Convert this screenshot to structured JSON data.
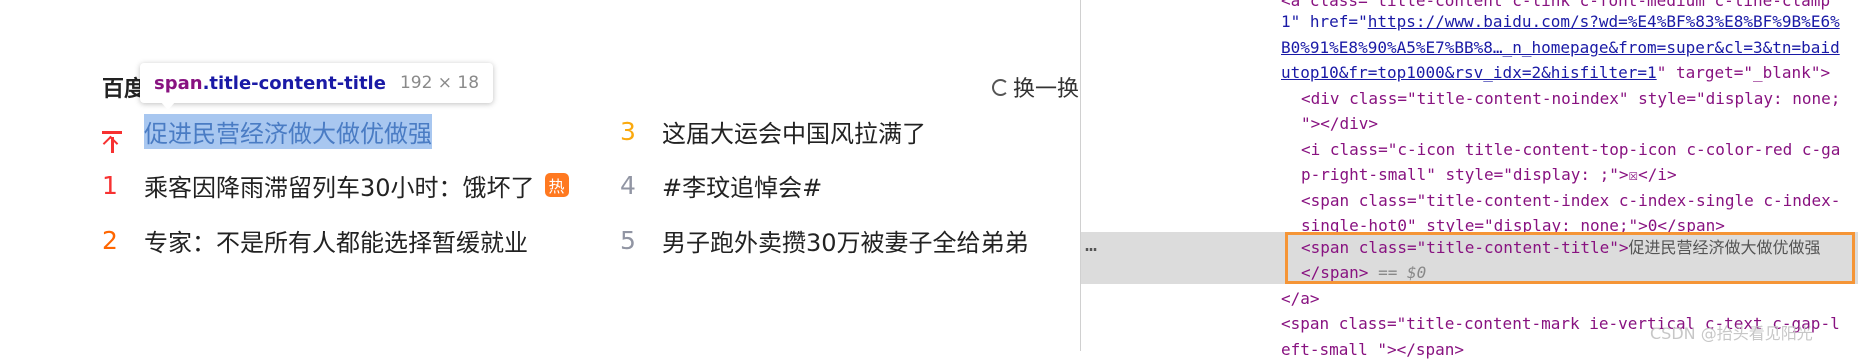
{
  "hot_search": {
    "title": "百度",
    "refresh_label": "换一换",
    "refresh_icon": "refresh-icon",
    "hot_badge": "热",
    "rows": [
      {
        "index": "",
        "title": "促进民营经济做大做优做强",
        "pinned": true
      },
      {
        "index": "1",
        "title": "乘客因降雨滞留列车30小时：饿坏了",
        "badge": "热"
      },
      {
        "index": "2",
        "title": "专家：不是所有人都能选择暂缓就业"
      },
      {
        "index": "3",
        "title": "这届大运会中国风拉满了"
      },
      {
        "index": "4",
        "title": "#李玟追悼会#"
      },
      {
        "index": "5",
        "title": "男子跑外卖攒30万被妻子全给弟弟"
      }
    ]
  },
  "tooltip": {
    "tag": "span",
    "class": ".title-content-title",
    "size": "192 × 18"
  },
  "devtools": {
    "line0": "<a class=\"title-content  c-link c-font-medium c-line-clamp",
    "line1_prefix": "1\" href=\"",
    "line1_link": "https://www.baidu.com/s?wd=%E4%BF%83%E8%BF%9B%E6%",
    "line2_link": "B0%91%E8%90%A5%E7%BB%8…_n_homepage&from=super&cl=3&tn=baid",
    "line3_link": "utop10&fr=top1000&rsv_idx=2&hisfilter=1",
    "line3_suffix": "\" target=\"_blank\">",
    "line4": "<div class=\"title-content-noindex\" style=\"display: none;",
    "line5": "\"></div>",
    "line6": "<i class=\"c-icon title-content-top-icon c-color-red c-ga",
    "line7": "p-right-small\" style=\"display: ;\">☒</i>",
    "line8": "<span class=\"title-content-index c-index-single c-index-",
    "line9": "single-hot0\" style=\"display: none;\">0</span>",
    "line10_tag": "<span class=\"title-content-title\">",
    "line10_text": "促进民营经济做大做优做强",
    "line11_close": "</span>",
    "line11_ref": " == $0",
    "line12": "</a>",
    "line13": "<span class=\"title-content-mark ie-vertical c-text c-gap-l",
    "line14": "eft-small \"></span>",
    "dots": "…"
  },
  "watermark": "CSDN @抬头看见阳光",
  "colors": {
    "index_red": "#f73131",
    "index_orange": "#ff6600",
    "index_amber": "#faa90e",
    "index_gray": "#9195a3",
    "selection": "#a8c7f0",
    "devtools_outline": "#f59536"
  }
}
